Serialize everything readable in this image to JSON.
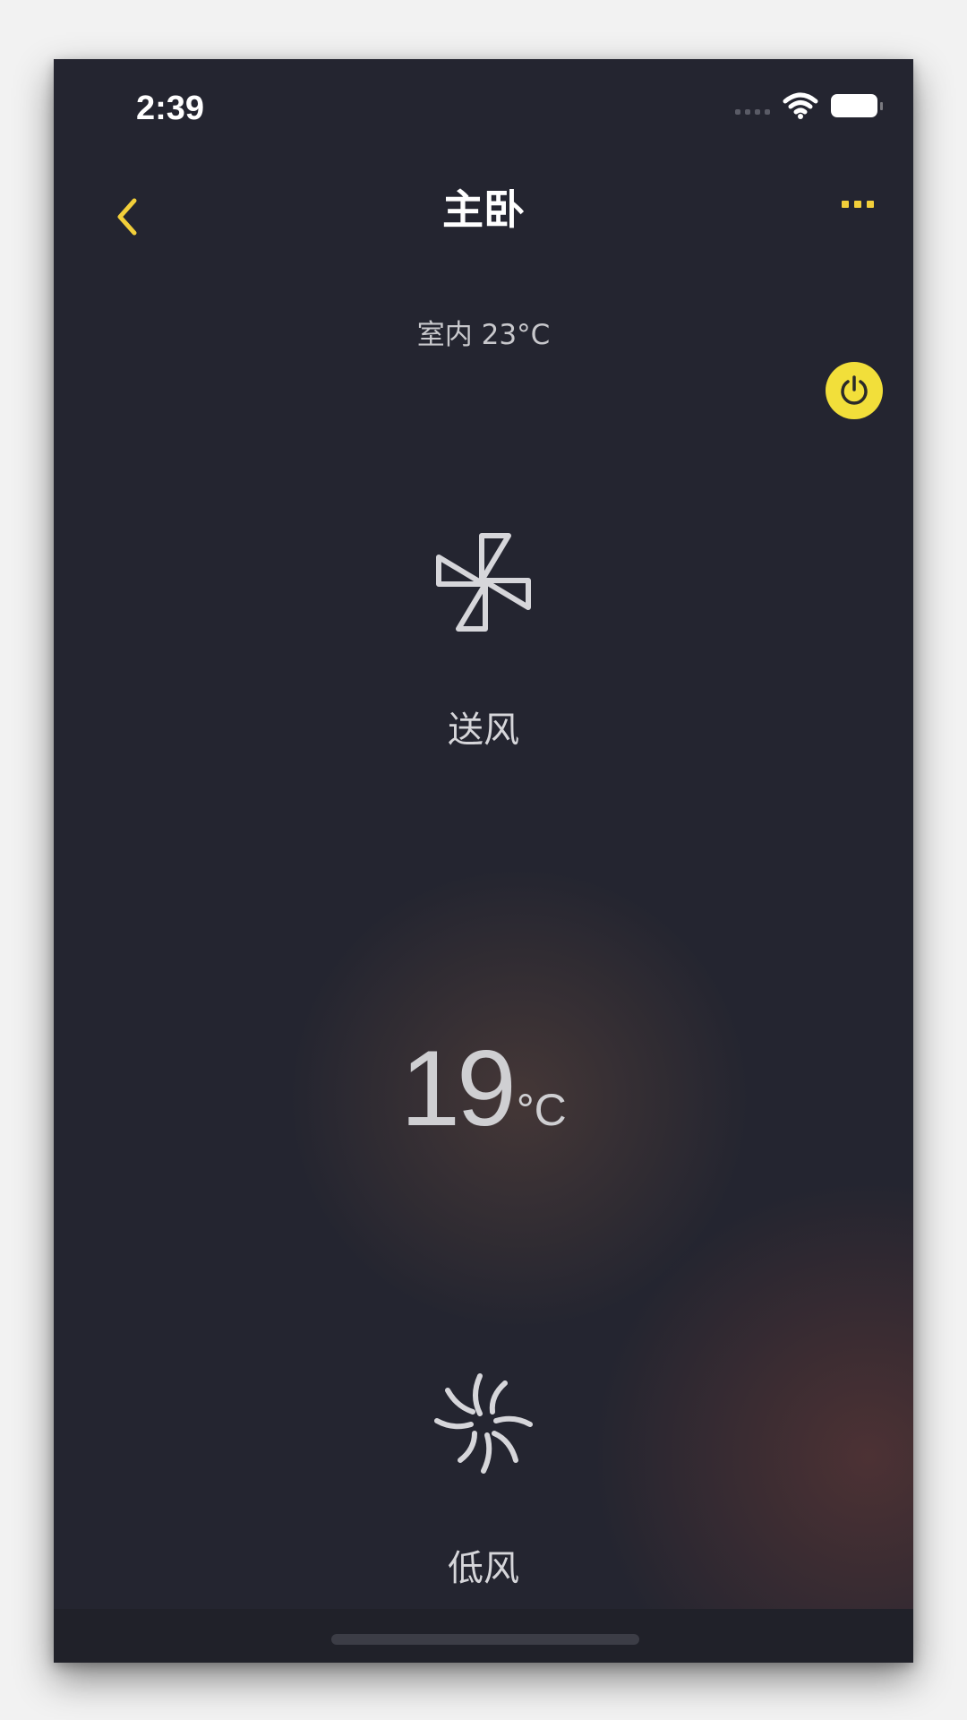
{
  "status_bar": {
    "time": "2:39"
  },
  "nav": {
    "title": "主卧",
    "back_icon": "chevron-left-icon",
    "more_icon": "more-dots-icon"
  },
  "indoor": {
    "label": "室内 23°C"
  },
  "power": {
    "icon": "power-icon",
    "color": "#f2df3a"
  },
  "mode": {
    "icon": "pinwheel-icon",
    "label": "送风"
  },
  "temperature": {
    "value": "19",
    "unit": "°C"
  },
  "wind": {
    "icon": "wind-swirl-icon",
    "label": "低风"
  },
  "colors": {
    "accent": "#f2cf3a",
    "background": "#242530",
    "text": "#d6d6da"
  }
}
